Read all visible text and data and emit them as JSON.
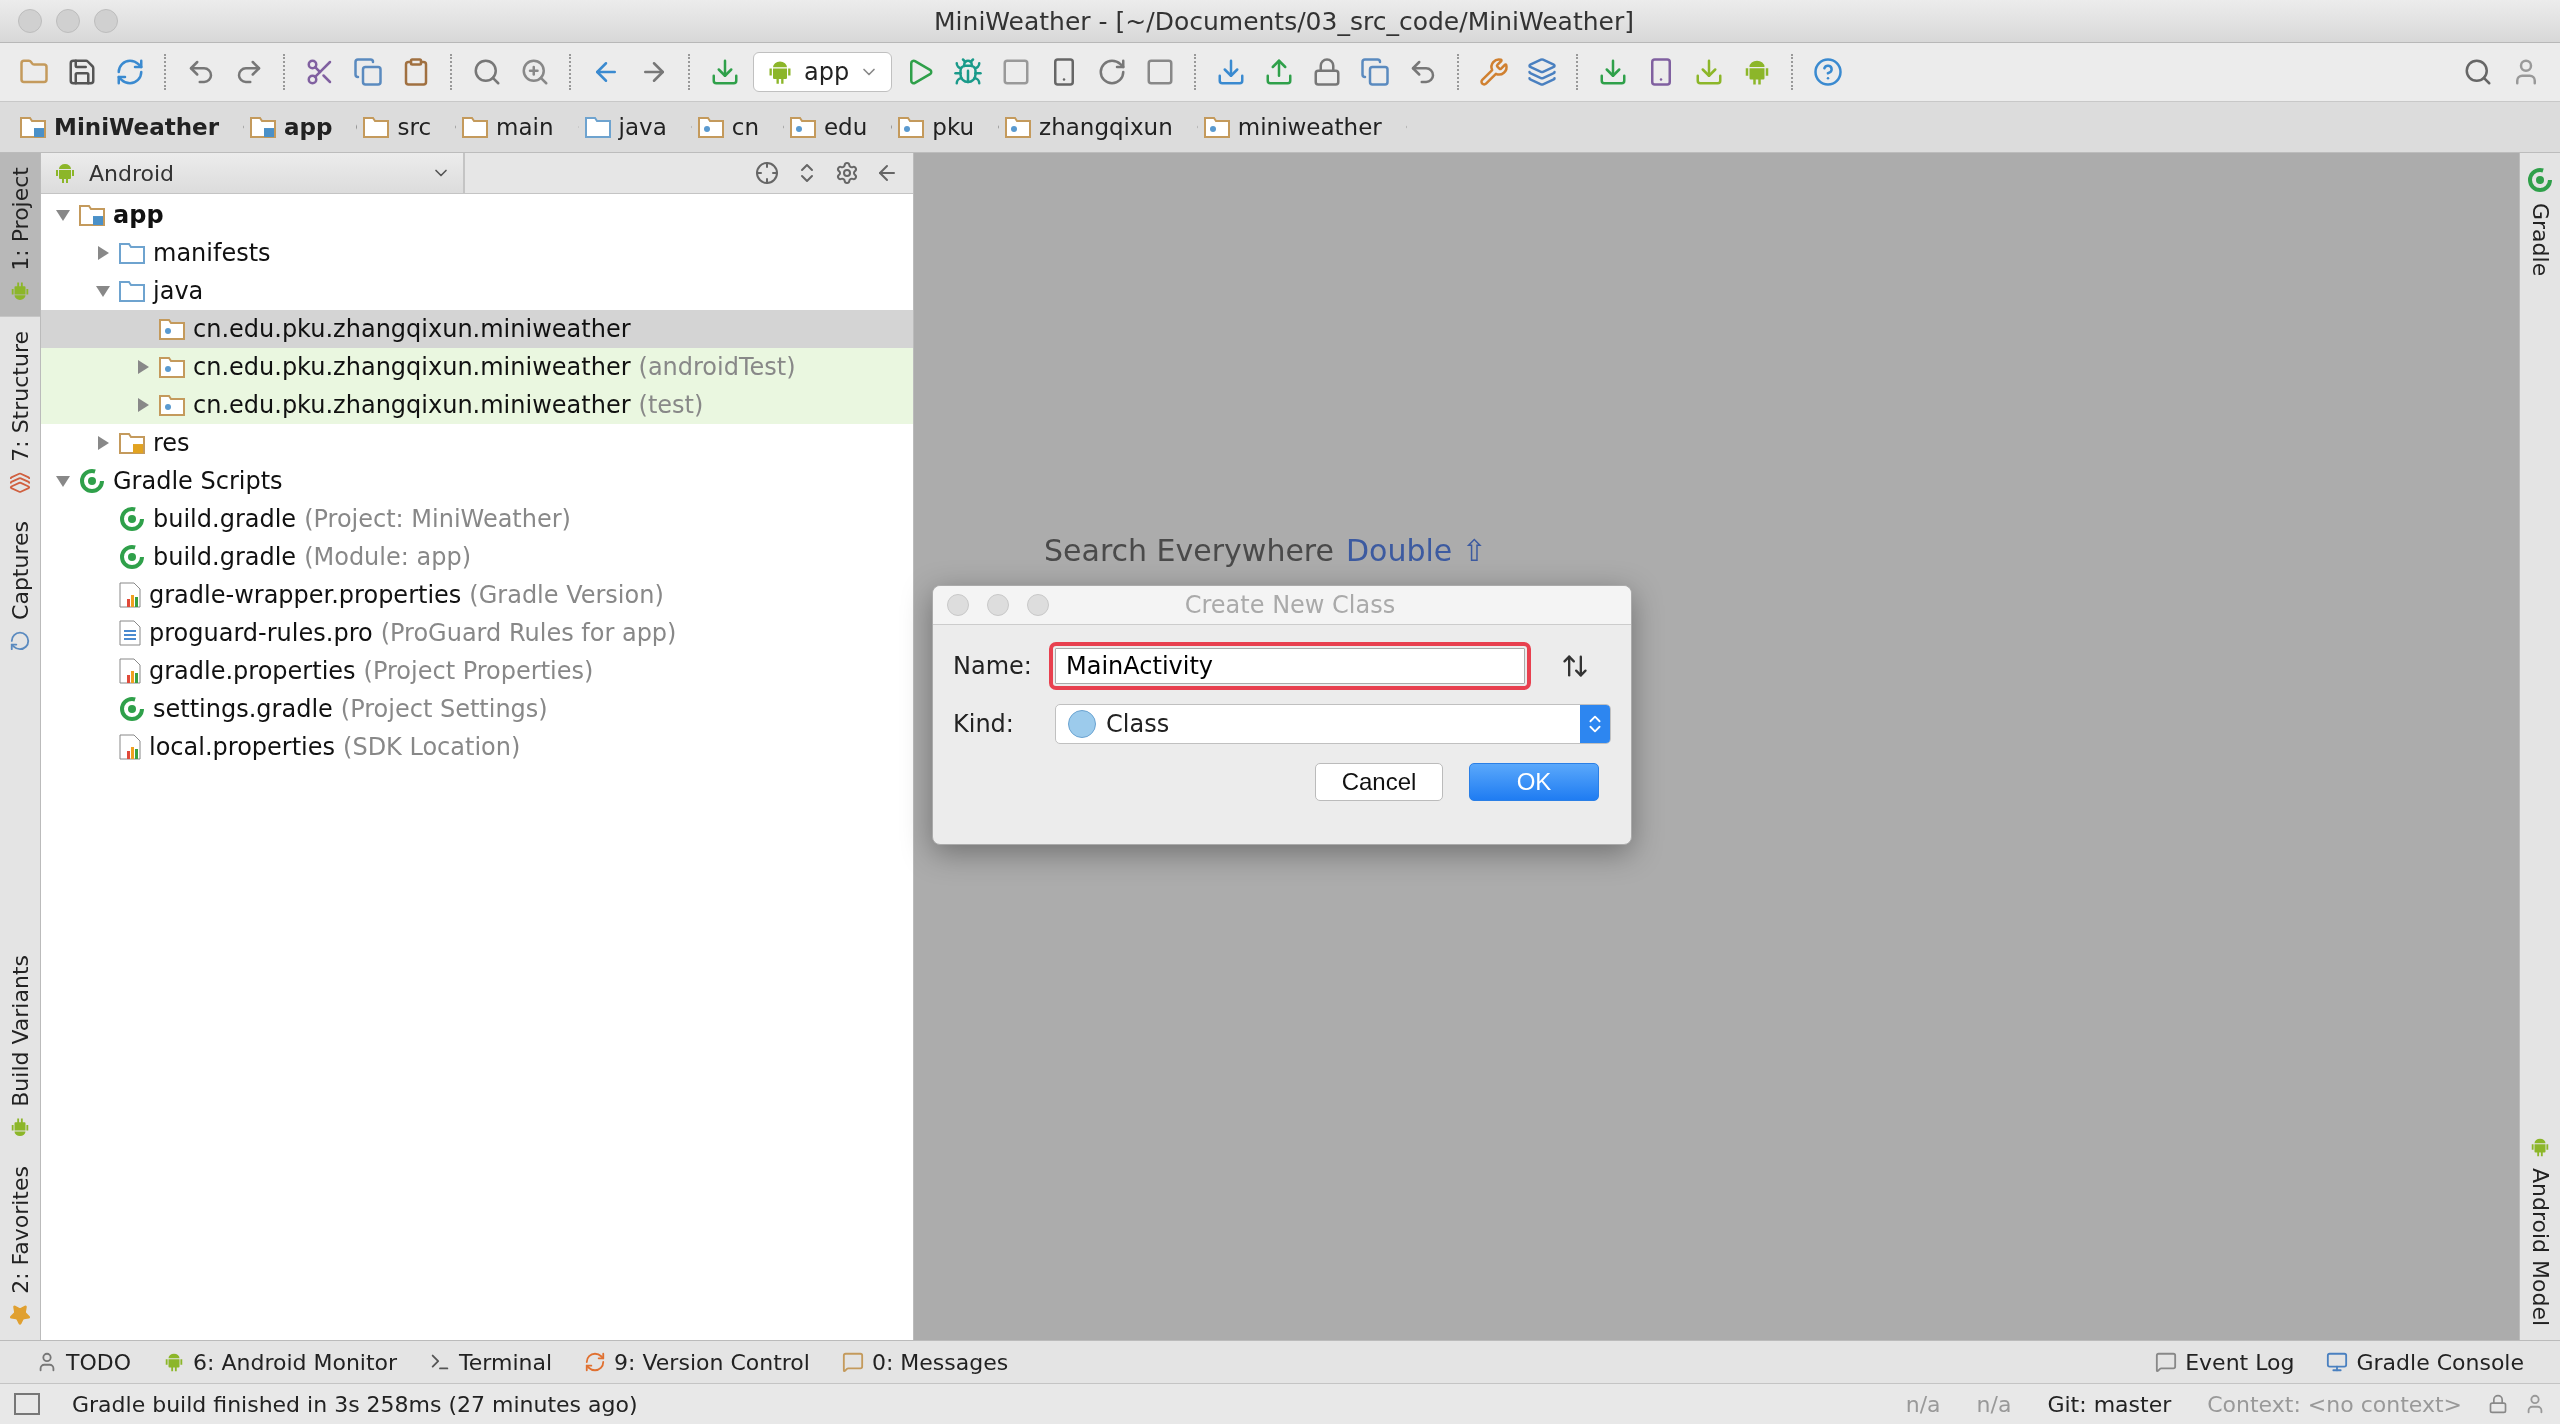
{
  "window": {
    "title": "MiniWeather - [~/Documents/03_src_code/MiniWeather]"
  },
  "toolbar": {
    "run_config": "app"
  },
  "breadcrumb": [
    {
      "label": "MiniWeather",
      "kind": "module"
    },
    {
      "label": "app",
      "kind": "module"
    },
    {
      "label": "src",
      "kind": "folder"
    },
    {
      "label": "main",
      "kind": "folder"
    },
    {
      "label": "java",
      "kind": "source"
    },
    {
      "label": "cn",
      "kind": "package"
    },
    {
      "label": "edu",
      "kind": "package"
    },
    {
      "label": "pku",
      "kind": "package"
    },
    {
      "label": "zhangqixun",
      "kind": "package"
    },
    {
      "label": "miniweather",
      "kind": "package"
    }
  ],
  "left_tool_windows": {
    "top": [
      {
        "label": "1: Project",
        "selected": true,
        "kind": "android"
      },
      {
        "label": "7: Structure",
        "selected": false,
        "kind": "structure"
      },
      {
        "label": "Captures",
        "selected": false,
        "kind": "captures"
      }
    ],
    "bottom": [
      {
        "label": "Build Variants",
        "selected": false,
        "kind": "android"
      },
      {
        "label": "2: Favorites",
        "selected": false,
        "kind": "star"
      }
    ]
  },
  "project_panel": {
    "view": "Android",
    "tree": [
      {
        "label": "app",
        "kind": "module",
        "expanded": true,
        "selected": false,
        "highlighted": false,
        "children": [
          {
            "label": "manifests",
            "kind": "source",
            "expanded": false,
            "selected": false,
            "highlighted": false
          },
          {
            "label": "java",
            "kind": "source",
            "expanded": true,
            "selected": false,
            "highlighted": false,
            "children": [
              {
                "label": "cn.edu.pku.zhangqixun.miniweather",
                "kind": "package",
                "selected": true,
                "highlighted": false
              },
              {
                "label": "cn.edu.pku.zhangqixun.miniweather",
                "note": "(androidTest)",
                "kind": "package",
                "expanded": false,
                "selected": false,
                "highlighted": true
              },
              {
                "label": "cn.edu.pku.zhangqixun.miniweather",
                "note": "(test)",
                "kind": "package",
                "expanded": false,
                "selected": false,
                "highlighted": true
              }
            ]
          },
          {
            "label": "res",
            "kind": "res",
            "expanded": false,
            "selected": false,
            "highlighted": false
          }
        ]
      },
      {
        "label": "Gradle Scripts",
        "kind": "gradle",
        "expanded": true,
        "selected": false,
        "highlighted": false,
        "children": [
          {
            "label": "build.gradle",
            "note": "(Project: MiniWeather)",
            "kind": "gradle",
            "selected": false,
            "highlighted": false
          },
          {
            "label": "build.gradle",
            "note": "(Module: app)",
            "kind": "gradle",
            "selected": false,
            "highlighted": false
          },
          {
            "label": "gradle-wrapper.properties",
            "note": "(Gradle Version)",
            "kind": "properties",
            "selected": false,
            "highlighted": false
          },
          {
            "label": "proguard-rules.pro",
            "note": "(ProGuard Rules for app)",
            "kind": "text",
            "selected": false,
            "highlighted": false
          },
          {
            "label": "gradle.properties",
            "note": "(Project Properties)",
            "kind": "properties",
            "selected": false,
            "highlighted": false
          },
          {
            "label": "settings.gradle",
            "note": "(Project Settings)",
            "kind": "gradle",
            "selected": false,
            "highlighted": false
          },
          {
            "label": "local.properties",
            "note": "(SDK Location)",
            "kind": "properties",
            "selected": false,
            "highlighted": false
          }
        ]
      }
    ]
  },
  "editor": {
    "hint": "Search Everywhere",
    "shortcut": "Double ⇧"
  },
  "dialog": {
    "title": "Create New Class",
    "name_label": "Name:",
    "name_value": "MainActivity",
    "kind_label": "Kind:",
    "kind_value": "Class",
    "buttons": [
      {
        "label": "Cancel",
        "kind": "secondary"
      },
      {
        "label": "OK",
        "kind": "primary"
      }
    ]
  },
  "right_tool_windows": {
    "top": [
      {
        "label": "Gradle",
        "kind": "gradle"
      }
    ],
    "bottom": [
      {
        "label": "Android Model",
        "kind": "android"
      }
    ]
  },
  "bottom_tool_windows": {
    "left": [
      {
        "label": "TODO",
        "kind": "todo"
      },
      {
        "label": "6: Android Monitor",
        "kind": "android"
      },
      {
        "label": "Terminal",
        "kind": "terminal"
      },
      {
        "label": "9: Version Control",
        "kind": "vcs"
      },
      {
        "label": "0: Messages",
        "kind": "messages"
      }
    ],
    "right": [
      {
        "label": "Event Log",
        "kind": "eventlog"
      },
      {
        "label": "Gradle Console",
        "kind": "console"
      }
    ]
  },
  "status_bar": {
    "message": "Gradle build finished in 3s 258ms (27 minutes ago)",
    "items": [
      "n/a",
      "n/a",
      "Git: master",
      "Context: <no context>"
    ]
  }
}
